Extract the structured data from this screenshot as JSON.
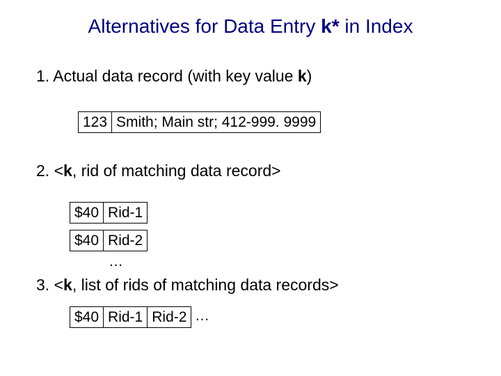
{
  "title": {
    "prefix": "Alternatives for Data Entry ",
    "kstar": "k*",
    "suffix": " in Index"
  },
  "item1": {
    "num": "1.",
    "text_before_k": "  Actual data record (with key value ",
    "k": "k",
    "text_after_k": ")"
  },
  "record1": {
    "key": "123",
    "value": " Smith;   Main str;  412-999. 9999"
  },
  "item2": {
    "num": "2.",
    "lt": " <",
    "k": "k",
    "rest": ", rid of matching data record>"
  },
  "pairs": [
    {
      "key": "$40",
      "rid": "Rid-1"
    },
    {
      "key": "$40",
      "rid": "Rid-2"
    }
  ],
  "dots": "…",
  "item3": {
    "num": "3.",
    "lt": " <",
    "k": "k",
    "rest": ", list of rids of matching data records>"
  },
  "list3": {
    "key": "$40",
    "rid1": "Rid-1",
    "rid2": "Rid-2"
  }
}
